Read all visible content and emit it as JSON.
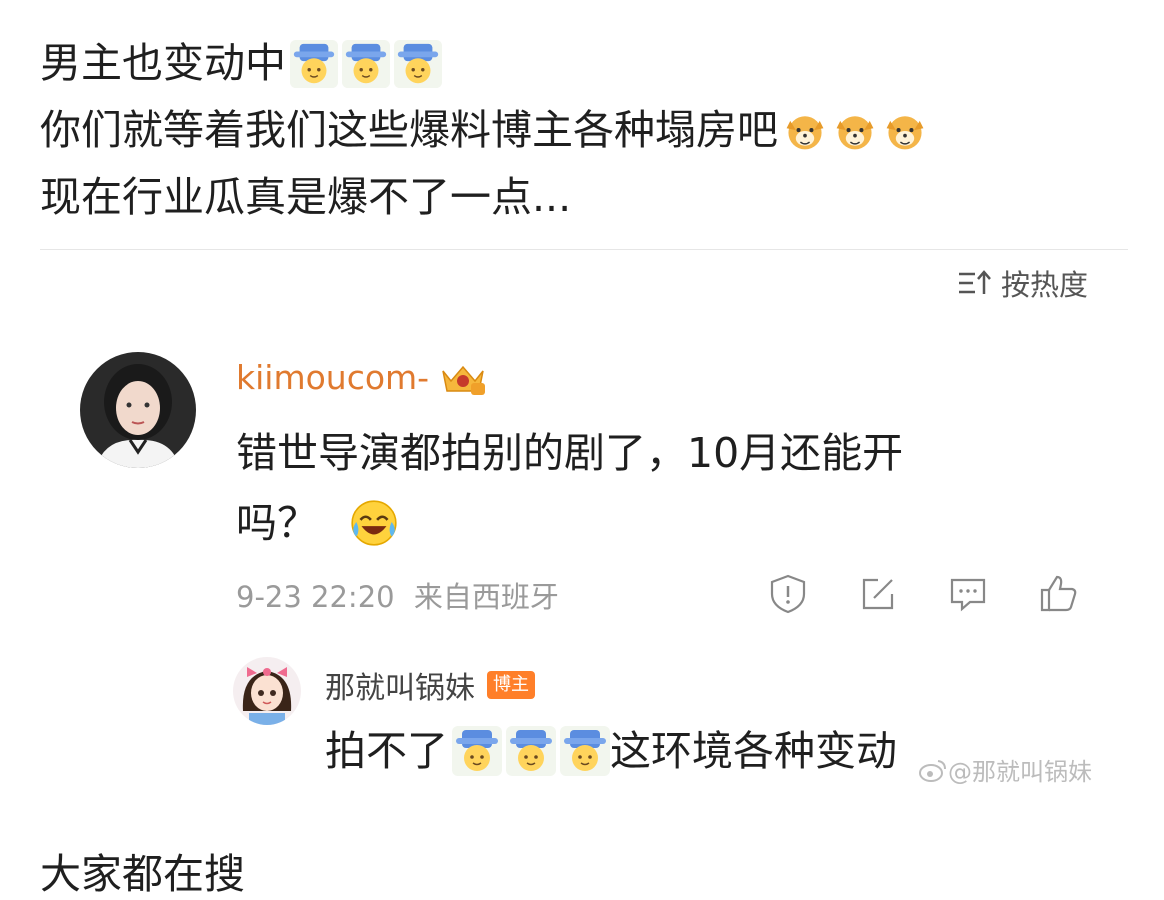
{
  "post": {
    "line1": "男主也变动中",
    "line2": "你们就等着我们这些爆料博主各种塌房吧",
    "line3": "现在行业瓜真是爆不了一点..."
  },
  "sort": {
    "label": "按热度",
    "icon": "sort-icon"
  },
  "comment": {
    "username": "kiimoucom-",
    "text_line1": "错世导演都拍别的剧了，10月还能开",
    "text_line2": "吗？",
    "timestamp": "9-23 22:20",
    "location": "来自西班牙",
    "actions": [
      "report-icon",
      "share-icon",
      "comment-icon",
      "like-icon"
    ]
  },
  "reply": {
    "username": "那就叫锅妹",
    "badge": "博主",
    "text_before": "拍不了",
    "text_after": "这环境各种变动"
  },
  "watermark": "@那就叫锅妹",
  "bottom_text": "大家都在搜",
  "colors": {
    "username": "#e07a2f",
    "badge": "#ff7f29",
    "meta": "#9a9a9a"
  }
}
